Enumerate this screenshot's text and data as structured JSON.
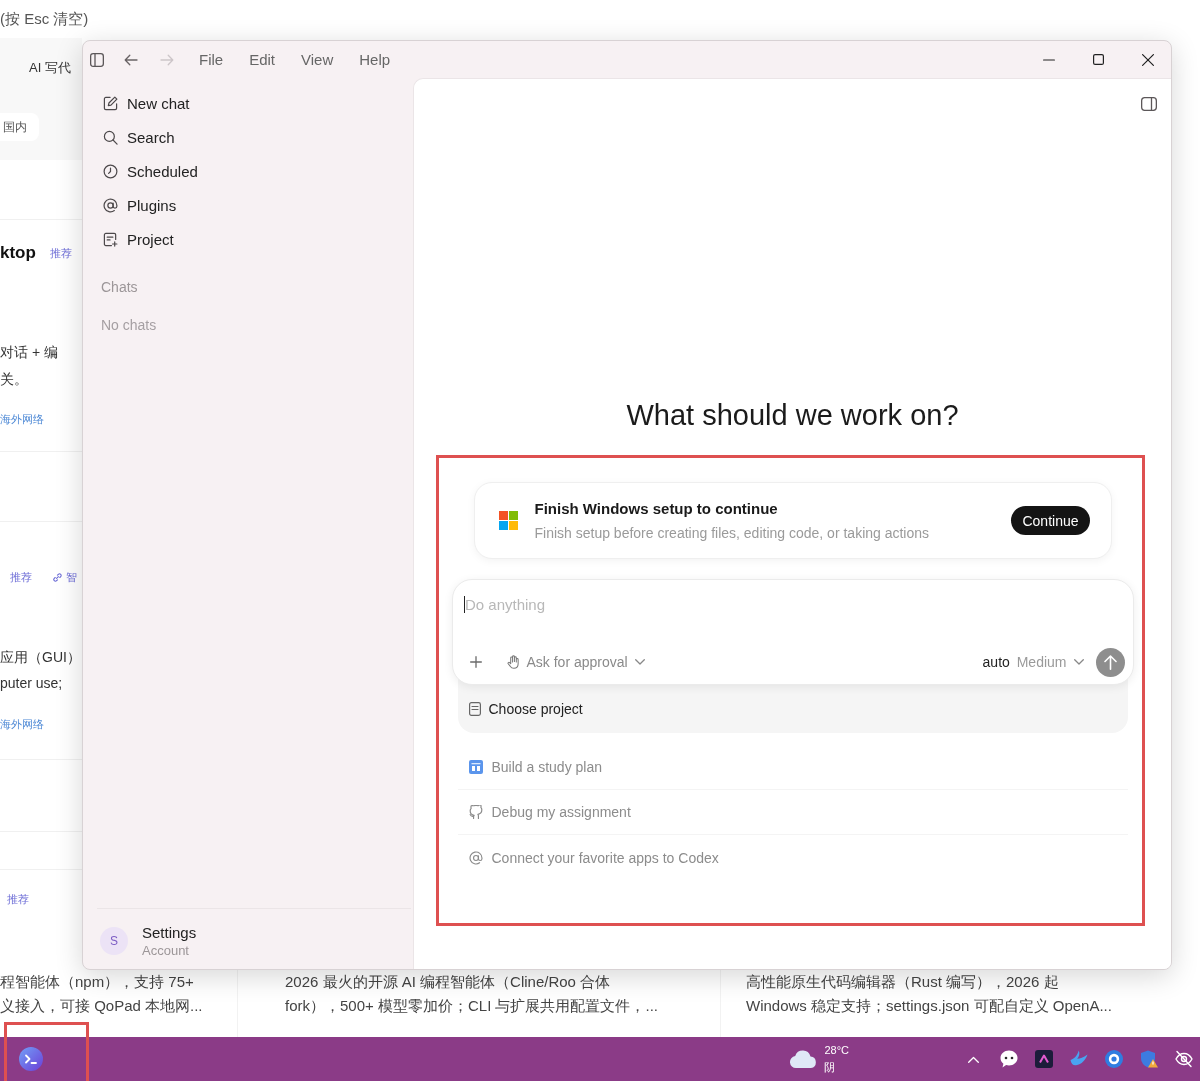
{
  "background_page": {
    "search_hint": "(按 Esc 清空)",
    "filter_tab": "AI 写代",
    "region_chip": "国内",
    "cards": [
      {
        "title": "ktop",
        "tags": [
          {
            "kind": "badge",
            "label": "推荐"
          }
        ],
        "description": [
          "对话 + 编",
          "关。"
        ],
        "note": "海外网络"
      },
      {
        "tags": [
          {
            "kind": "badge",
            "label": "推荐"
          },
          {
            "kind": "link",
            "label": "智"
          }
        ],
        "description": [
          "应用（GUI）",
          "puter use;"
        ],
        "note": "海外网络"
      },
      {
        "tags": [
          {
            "kind": "badge",
            "label": "推荐"
          }
        ]
      }
    ],
    "bottom_descriptions": [
      [
        "程智能体（npm），支持 75+",
        "义接入，可接 QoPad 本地网..."
      ],
      [
        "2026 最火的开源 AI 编程智能体（Cline/Roo 合体",
        "fork），500+ 模型零加价；CLI 与扩展共用配置文件，..."
      ],
      [
        "高性能原生代码编辑器（Rust 编写），2026 起",
        "Windows 稳定支持；settings.json 可配自定义 OpenA..."
      ]
    ]
  },
  "window": {
    "navigation": [
      {
        "kind": "back",
        "disabled": false
      },
      {
        "kind": "forward",
        "disabled": true
      }
    ],
    "menu": [
      "File",
      "Edit",
      "View",
      "Help"
    ],
    "sidebar": {
      "items": [
        {
          "kind": "new-chat",
          "label": "New chat"
        },
        {
          "kind": "search",
          "label": "Search"
        },
        {
          "kind": "scheduled",
          "label": "Scheduled"
        },
        {
          "kind": "plugins",
          "label": "Plugins"
        },
        {
          "kind": "project",
          "label": "Project"
        }
      ],
      "section_title": "Chats",
      "empty_text": "No chats",
      "account": {
        "initial": "S",
        "title": "Settings",
        "subtitle": "Account"
      }
    },
    "main": {
      "heading": "What should we work on?",
      "setup_card": {
        "title": "Finish Windows setup to continue",
        "description": "Finish setup before creating files, editing code, or taking actions",
        "button": "Continue"
      },
      "composer": {
        "placeholder": "Do anything",
        "focused": true,
        "approval": "Ask for approval",
        "mode": "auto",
        "effort": "Medium",
        "send_disabled": true
      },
      "project_picker": "Choose project",
      "suggestions": [
        {
          "kind": "calendar",
          "label": "Build a study plan"
        },
        {
          "kind": "github",
          "label": "Debug my assignment"
        },
        {
          "kind": "apps",
          "label": "Connect your favorite apps to Codex"
        }
      ]
    }
  },
  "taskbar": {
    "weather": {
      "temperature": "28°C",
      "condition": "阴"
    }
  }
}
